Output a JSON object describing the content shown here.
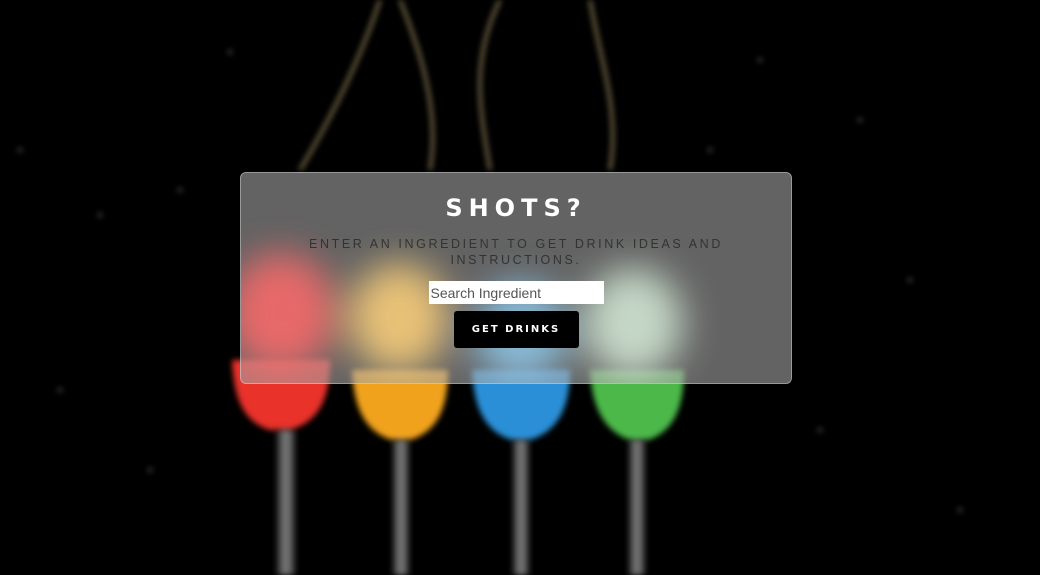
{
  "page": {
    "background": "#000000",
    "background_art": "four-colored-shot-glasses-splash"
  },
  "card": {
    "title": "SHOTS?",
    "subtitle": "ENTER AN INGREDIENT TO GET DRINK IDEAS AND INSTRUCTIONS.",
    "search": {
      "placeholder": "Search Ingredient",
      "value": ""
    },
    "button_label": "GET DRINKS"
  },
  "colors": {
    "drink_red": "#e8322a",
    "drink_orange": "#f0a21b",
    "drink_blue": "#2b8fd6",
    "drink_green": "#4cb84a",
    "card_overlay": "#a0a0a0",
    "button_bg": "#000000"
  }
}
